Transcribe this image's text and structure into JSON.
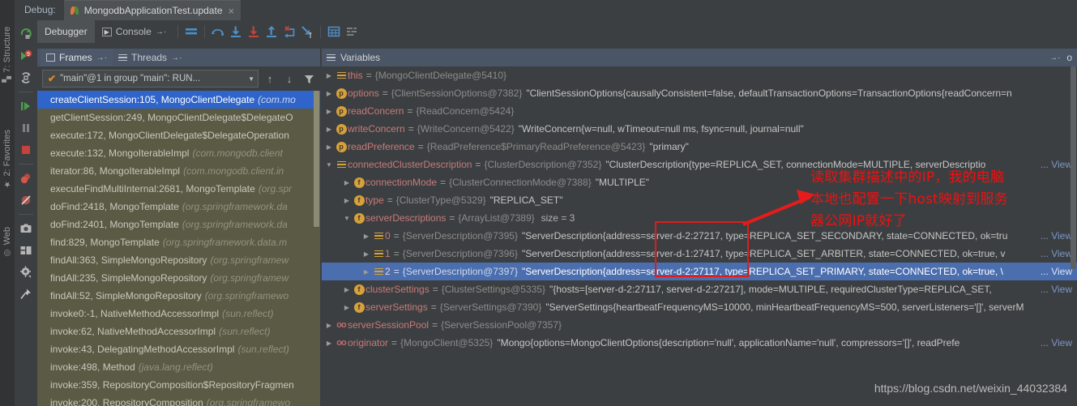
{
  "window": {
    "debug_label": "Debug:",
    "run_tab_title": "MongodbApplicationTest.update",
    "close_glyph": "×"
  },
  "subtoolbar": {
    "tabs": [
      {
        "label": "Debugger",
        "icon": "hamburger-icon",
        "active": true
      },
      {
        "label": "Console",
        "icon": "console-icon",
        "active": false
      }
    ],
    "pin_arrow": "→·",
    "icons": [
      "layout-equal-icon",
      "step-over-icon",
      "step-into-icon",
      "force-step-into-icon",
      "step-out-icon",
      "drop-frame-icon",
      "run-to-cursor-icon",
      "evaluate-expression-icon",
      "settings-rows-icon"
    ]
  },
  "left_rail": {
    "icons": [
      "rerun-icon",
      "debug-9-icon",
      "restart-frames-icon",
      "resume-program-icon",
      "pause-program-icon",
      "stop-icon",
      "view-breakpoints-icon",
      "mute-breakpoints-icon",
      "screenshot-icon",
      "layout-icon",
      "settings-gear-icon",
      "pin-icon"
    ]
  },
  "vertical_bar": {
    "items": [
      {
        "label": "7: Structure",
        "icon": "structure-icon"
      },
      {
        "label": "2: Favorites",
        "icon": "star-icon"
      },
      {
        "label": "Web",
        "icon": "web-icon"
      }
    ]
  },
  "frames_panel": {
    "tabs": [
      {
        "label": "Frames",
        "icon": "frames-icon",
        "pin": "→·",
        "active": true
      },
      {
        "label": "Threads",
        "icon": "threads-icon",
        "pin": "→·",
        "active": false
      }
    ],
    "thread_selector": {
      "value": "\"main\"@1 in group \"main\": RUN...",
      "check": "✔",
      "arrow": "▼"
    },
    "nav_buttons": [
      "up-stack-icon",
      "down-stack-icon",
      "filter-icon"
    ],
    "frames": [
      {
        "method": "createClientSession:105, MongoClientDelegate",
        "pkg": "(com.mo",
        "selected": true
      },
      {
        "method": "getClientSession:249, MongoClientDelegate$DelegateO",
        "pkg": "",
        "selected": false
      },
      {
        "method": "execute:172, MongoClientDelegate$DelegateOperation",
        "pkg": "",
        "selected": false
      },
      {
        "method": "execute:132, MongoIterableImpl",
        "pkg": "(com.mongodb.client",
        "selected": false
      },
      {
        "method": "iterator:86, MongoIterableImpl",
        "pkg": "(com.mongodb.client.in",
        "selected": false
      },
      {
        "method": "executeFindMultiInternal:2681, MongoTemplate",
        "pkg": "(org.spr",
        "selected": false
      },
      {
        "method": "doFind:2418, MongoTemplate",
        "pkg": "(org.springframework.da",
        "selected": false
      },
      {
        "method": "doFind:2401, MongoTemplate",
        "pkg": "(org.springframework.da",
        "selected": false
      },
      {
        "method": "find:829, MongoTemplate",
        "pkg": "(org.springframework.data.m",
        "selected": false
      },
      {
        "method": "findAll:363, SimpleMongoRepository",
        "pkg": "(org.springframew",
        "selected": false
      },
      {
        "method": "findAll:235, SimpleMongoRepository",
        "pkg": "(org.springframew",
        "selected": false
      },
      {
        "method": "findAll:52, SimpleMongoRepository",
        "pkg": "(org.springframewo",
        "selected": false
      },
      {
        "method": "invoke0:-1, NativeMethodAccessorImpl",
        "pkg": "(sun.reflect)",
        "selected": false
      },
      {
        "method": "invoke:62, NativeMethodAccessorImpl",
        "pkg": "(sun.reflect)",
        "selected": false
      },
      {
        "method": "invoke:43, DelegatingMethodAccessorImpl",
        "pkg": "(sun.reflect)",
        "selected": false
      },
      {
        "method": "invoke:498, Method",
        "pkg": "(java.lang.reflect)",
        "selected": false
      },
      {
        "method": "invoke:359, RepositoryComposition$RepositoryFragmen",
        "pkg": "",
        "selected": false
      },
      {
        "method": "invoke:200, RepositoryComposition",
        "pkg": "(org.springframewo",
        "selected": false
      }
    ]
  },
  "variables_panel": {
    "title": "Variables",
    "pin_arrow": "→·",
    "overflow_label": "o",
    "view_label": "View",
    "rows": [
      {
        "indent": 1,
        "twisty": "▶",
        "icon": "list-icon",
        "icon_char": "",
        "name": "this",
        "eq": "=",
        "ref": "{MongoClientDelegate@5410}",
        "value": "",
        "size": "",
        "view": false
      },
      {
        "indent": 1,
        "twisty": "▶",
        "icon": "field-p-icon",
        "icon_char": "p",
        "name": "options",
        "eq": "=",
        "ref": "{ClientSessionOptions@7382}",
        "value": "\"ClientSessionOptions{causallyConsistent=false, defaultTransactionOptions=TransactionOptions{readConcern=n",
        "size": "",
        "view": false
      },
      {
        "indent": 1,
        "twisty": "▶",
        "icon": "field-p-icon",
        "icon_char": "p",
        "name": "readConcern",
        "eq": "=",
        "ref": "{ReadConcern@5424}",
        "value": "",
        "size": "",
        "view": false
      },
      {
        "indent": 1,
        "twisty": "▶",
        "icon": "field-p-icon",
        "icon_char": "p",
        "name": "writeConcern",
        "eq": "=",
        "ref": "{WriteConcern@5422}",
        "value": "\"WriteConcern{w=null, wTimeout=null ms, fsync=null, journal=null\"",
        "size": "",
        "view": false
      },
      {
        "indent": 1,
        "twisty": "▶",
        "icon": "field-p-icon",
        "icon_char": "p",
        "name": "readPreference",
        "eq": "=",
        "ref": "{ReadPreference$PrimaryReadPreference@5423}",
        "value": "\"primary\"",
        "size": "",
        "view": false
      },
      {
        "indent": 1,
        "twisty": "▼",
        "icon": "list-icon",
        "icon_char": "",
        "name": "connectedClusterDescription",
        "eq": "=",
        "ref": "{ClusterDescription@7352}",
        "value": "\"ClusterDescription{type=REPLICA_SET, connectionMode=MULTIPLE, serverDescriptio",
        "size": "",
        "view": true,
        "truncate": true
      },
      {
        "indent": 2,
        "twisty": "▶",
        "icon": "field-f-icon",
        "icon_char": "f",
        "name": "connectionMode",
        "eq": "=",
        "ref": "{ClusterConnectionMode@7388}",
        "value": "\"MULTIPLE\"",
        "size": "",
        "view": false
      },
      {
        "indent": 2,
        "twisty": "▶",
        "icon": "field-f-icon",
        "icon_char": "f",
        "name": "type",
        "eq": "=",
        "ref": "{ClusterType@5329}",
        "value": "\"REPLICA_SET\"",
        "size": "",
        "view": false
      },
      {
        "indent": 2,
        "twisty": "▼",
        "icon": "field-f-icon",
        "icon_char": "f",
        "name": "serverDescriptions",
        "eq": "=",
        "ref": "{ArrayList@7389}",
        "value": "",
        "size": "size = 3",
        "view": false
      },
      {
        "indent": 3,
        "twisty": "▶",
        "icon": "list-icon",
        "icon_char": "",
        "name": "0",
        "eq": "=",
        "ref": "{ServerDescription@7395}",
        "value": "\"ServerDescription{address=server-d-2:27217, type=REPLICA_SET_SECONDARY, state=CONNECTED, ok=tru",
        "size": "",
        "view": true,
        "truncate": true
      },
      {
        "indent": 3,
        "twisty": "▶",
        "icon": "list-icon",
        "icon_char": "",
        "name": "1",
        "eq": "=",
        "ref": "{ServerDescription@7396}",
        "value": "\"ServerDescription{address=server-d-1:27417, type=REPLICA_SET_ARBITER, state=CONNECTED, ok=true, v",
        "size": "",
        "view": true,
        "truncate": true
      },
      {
        "indent": 3,
        "twisty": "▶",
        "icon": "list-icon",
        "icon_char": "",
        "name": "2",
        "eq": "=",
        "ref": "{ServerDescription@7397}",
        "value": "\"ServerDescription{address=server-d-2:27117, type=REPLICA_SET_PRIMARY, state=CONNECTED, ok=true, \\",
        "size": "",
        "view": true,
        "truncate": true,
        "selected": true
      },
      {
        "indent": 2,
        "twisty": "▶",
        "icon": "field-f-icon",
        "icon_char": "f",
        "name": "clusterSettings",
        "eq": "=",
        "ref": "{ClusterSettings@5335}",
        "value": "\"{hosts=[server-d-2:27117, server-d-2:27217], mode=MULTIPLE, requiredClusterType=REPLICA_SET,",
        "size": "",
        "view": true,
        "truncate": true
      },
      {
        "indent": 2,
        "twisty": "▶",
        "icon": "field-f-icon",
        "icon_char": "f",
        "name": "serverSettings",
        "eq": "=",
        "ref": "{ServerSettings@7390}",
        "value": "\"ServerSettings{heartbeatFrequencyMS=10000, minHeartbeatFrequencyMS=500, serverListeners='[]', serverM",
        "size": "",
        "view": false
      },
      {
        "indent": 1,
        "twisty": "▶",
        "icon": "static-oo-icon",
        "icon_char": "oo",
        "name": "serverSessionPool",
        "eq": "=",
        "ref": "{ServerSessionPool@7357}",
        "value": "",
        "size": "",
        "view": false
      },
      {
        "indent": 1,
        "twisty": "▶",
        "icon": "static-oo-icon",
        "icon_char": "oo",
        "name": "originator",
        "eq": "=",
        "ref": "{MongoClient@5325}",
        "value": "\"Mongo{options=MongoClientOptions{description='null', applicationName='null', compressors='[]', readPrefe",
        "size": "",
        "view": true,
        "truncate": true
      }
    ]
  },
  "annotation": {
    "text_lines": [
      "读取集群描述中的IP，我的电脑",
      "本地也配置一下host映射到服务",
      "器公网IP就好了"
    ],
    "color": "#ee1111",
    "arrow_name": "red-arrow-annotation",
    "box_name": "red-highlight-box"
  },
  "watermark": {
    "text": "https://blog.csdn.net/weixin_44032384"
  },
  "colors": {
    "background": "#3c3f41",
    "panel_header": "#4a5566",
    "frames_bg": "#5a5a45",
    "selection_blue": "#4b6eaf",
    "frame_selection": "#2f65ca",
    "var_name": "#c77a7a",
    "icon_gold": "#d6a13b",
    "link": "#7a96c8",
    "annotation_red": "#ee1111"
  }
}
